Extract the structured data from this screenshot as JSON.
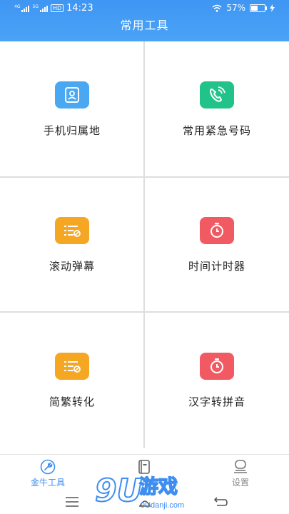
{
  "status_bar": {
    "time": "14:23",
    "network_4g": "4G",
    "network_5g": "5G",
    "hd": "HD",
    "battery": "57%",
    "battery_level": 0.57
  },
  "header": {
    "title": "常用工具"
  },
  "tools": [
    {
      "label": "手机归属地",
      "icon": "contact-card-icon",
      "color": "#4aa8f2"
    },
    {
      "label": "常用紧急号码",
      "icon": "phone-call-icon",
      "color": "#22c38a"
    },
    {
      "label": "滚动弹幕",
      "icon": "scroll-list-icon",
      "color": "#f5a623"
    },
    {
      "label": "时间计时器",
      "icon": "stopwatch-icon",
      "color": "#f25a63"
    },
    {
      "label": "简繁转化",
      "icon": "convert-list-icon",
      "color": "#f5a623"
    },
    {
      "label": "汉字转拼音",
      "icon": "stopwatch-icon",
      "color": "#f25a63"
    }
  ],
  "tabbar": {
    "tabs": [
      {
        "label": "金牛工具",
        "icon": "wrench-icon",
        "active": true
      },
      {
        "label": "",
        "icon": "book-icon",
        "active": false
      },
      {
        "label": "设置",
        "icon": "settings-icon",
        "active": false
      }
    ]
  },
  "watermark": {
    "text": "游戏",
    "brand": "9U",
    "url": "9Udanji.com"
  },
  "colors": {
    "header": "#3f96f3",
    "accent": "#3d8ef0"
  }
}
